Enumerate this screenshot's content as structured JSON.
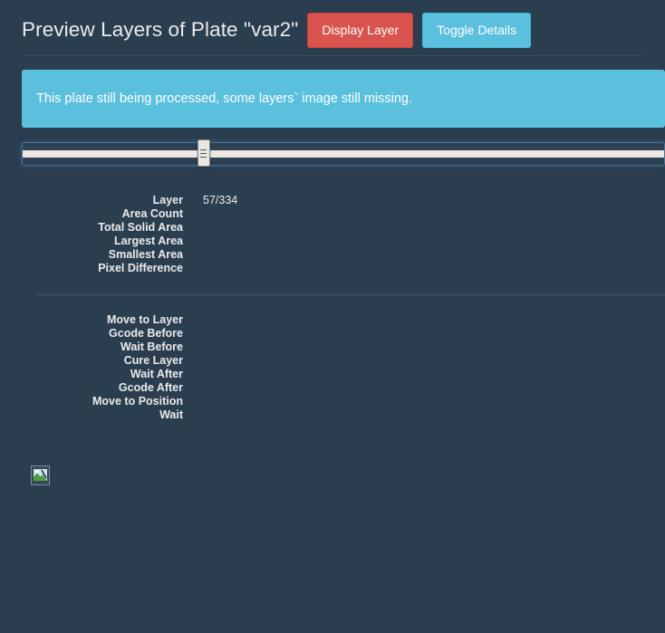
{
  "header": {
    "title": "Preview Layers of Plate \"var2\"",
    "buttons": [
      {
        "label": "Display Layer",
        "style": "danger",
        "name": "display-layer-button"
      },
      {
        "label": "Toggle Details",
        "style": "info",
        "name": "toggle-details-button"
      }
    ]
  },
  "alert": {
    "message": "This plate still being processed, some layers` image still missing.",
    "type": "info",
    "color": "#5bc0de"
  },
  "slider": {
    "name": "layer-slider",
    "value": 57,
    "min": 1,
    "max": 334,
    "handle_percent": 28.2
  },
  "details": {
    "layer_stats": [
      {
        "label": "Layer",
        "value": "57/334"
      },
      {
        "label": "Area Count",
        "value": ""
      },
      {
        "label": "Total Solid Area",
        "value": ""
      },
      {
        "label": "Largest Area",
        "value": ""
      },
      {
        "label": "Smallest Area",
        "value": ""
      },
      {
        "label": "Pixel Difference",
        "value": ""
      }
    ],
    "layer_actions": [
      {
        "label": "Move to Layer",
        "value": ""
      },
      {
        "label": "Gcode Before",
        "value": ""
      },
      {
        "label": "Wait Before",
        "value": ""
      },
      {
        "label": "Cure Layer",
        "value": ""
      },
      {
        "label": "Wait After",
        "value": ""
      },
      {
        "label": "Gcode After",
        "value": ""
      },
      {
        "label": "Move to Position",
        "value": ""
      },
      {
        "label": "Wait",
        "value": ""
      }
    ]
  },
  "preview": {
    "image_alt": "",
    "broken": true
  },
  "theme": {
    "background": "#2b3e50",
    "text": "#ebebeb",
    "danger": "#d9534f",
    "info": "#5bc0de",
    "divider": "#3d5670"
  }
}
